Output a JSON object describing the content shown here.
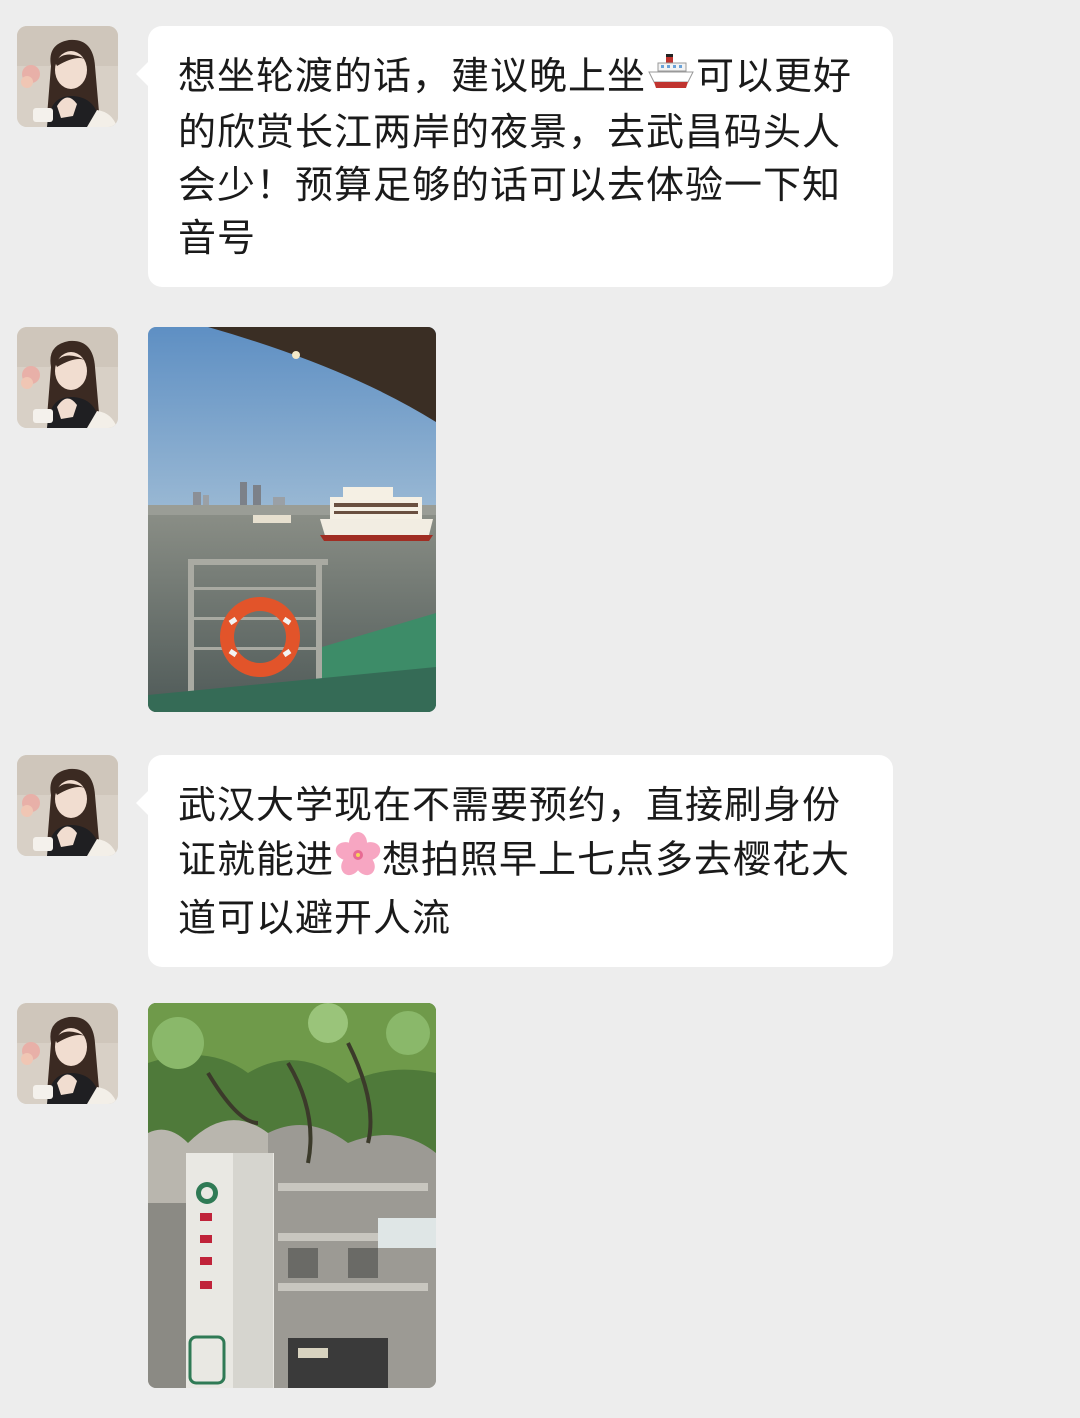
{
  "messages": [
    {
      "type": "text",
      "text_before_emoji": "想坐轮渡的话，建议晚上坐",
      "emoji": "ship-icon",
      "text_after_emoji": "可以更好的欣赏长江两岸的夜景，去武昌码头人会少！预算足够的话可以去体验一下知音号"
    },
    {
      "type": "image",
      "image": "ferry-on-yangtze-river-photo"
    },
    {
      "type": "text",
      "text_before_emoji": "武汉大学现在不需要预约，直接刷身份证就能进",
      "emoji": "cherry-blossom-icon",
      "text_after_emoji": "想拍照早上七点多去樱花大道可以避开人流"
    },
    {
      "type": "image",
      "image": "wuhan-university-gate-photo"
    }
  ],
  "colors": {
    "background": "#ededed",
    "bubble": "#ffffff",
    "text": "#1a1a1a"
  }
}
